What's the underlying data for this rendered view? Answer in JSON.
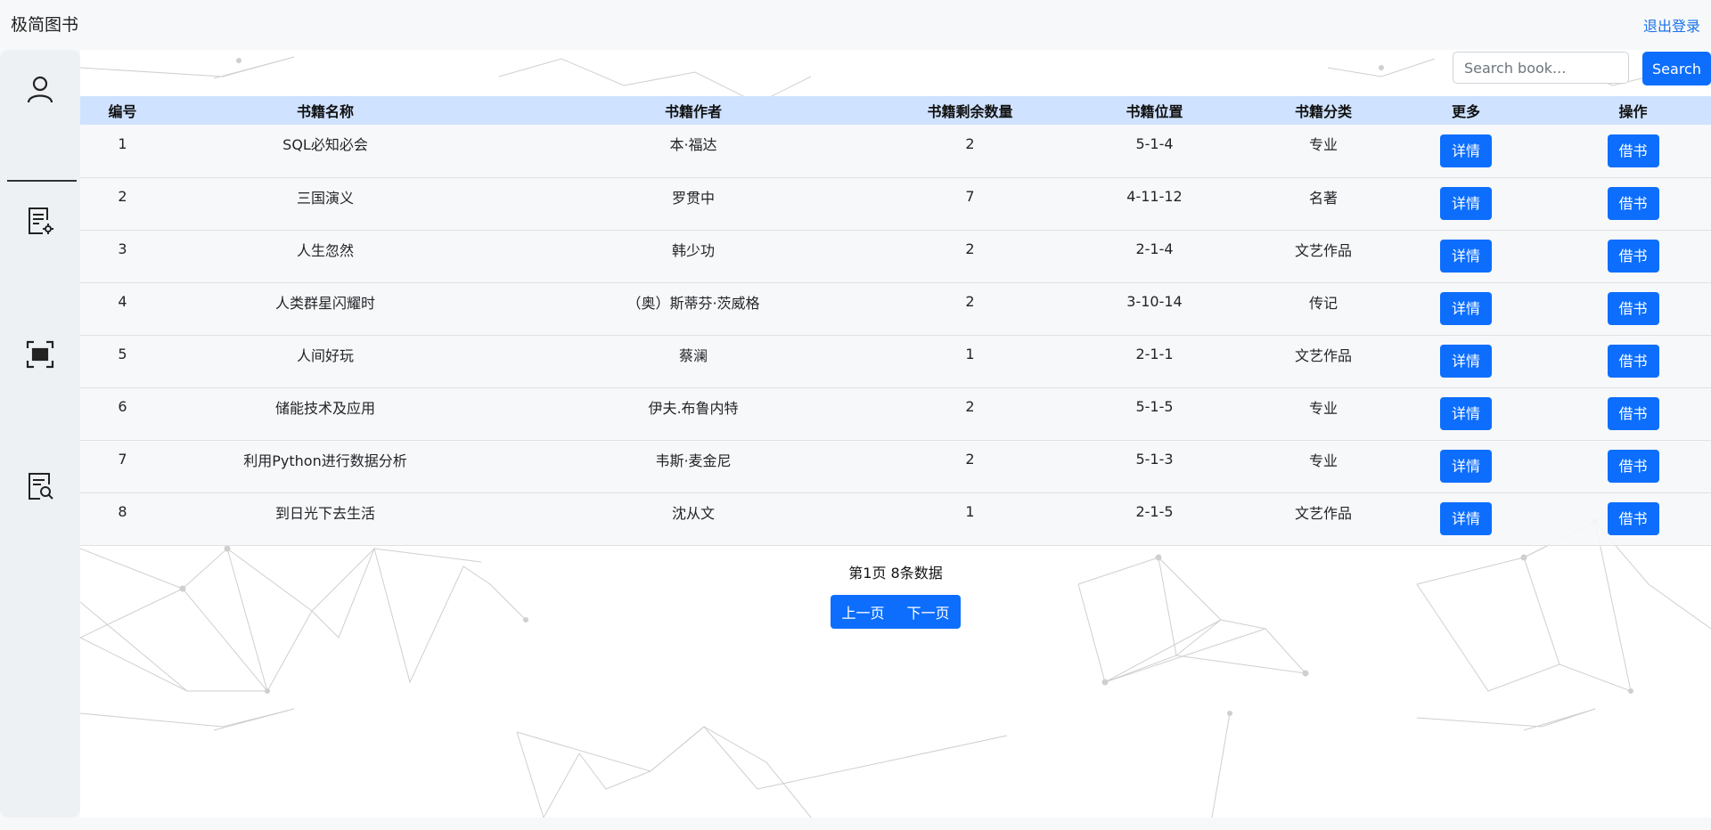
{
  "header": {
    "brand": "极简图书",
    "logout": "退出登录"
  },
  "sidebar": {
    "items": [
      {
        "icon": "user-icon"
      },
      {
        "icon": "book-settings-icon"
      },
      {
        "icon": "scan-icon"
      },
      {
        "icon": "book-search-icon"
      }
    ]
  },
  "search": {
    "placeholder": "Search book...",
    "button": "Search"
  },
  "table": {
    "headers": [
      "编号",
      "书籍名称",
      "书籍作者",
      "书籍剩余数量",
      "书籍位置",
      "书籍分类",
      "更多",
      "操作"
    ],
    "detail_label": "详情",
    "borrow_label": "借书",
    "rows": [
      [
        "1",
        "SQL必知必会",
        "本·福达",
        "2",
        "5-1-4",
        "专业"
      ],
      [
        "2",
        "三国演义",
        "罗贯中",
        "7",
        "4-11-12",
        "名著"
      ],
      [
        "3",
        "人生忽然",
        "韩少功",
        "2",
        "2-1-4",
        "文艺作品"
      ],
      [
        "4",
        "人类群星闪耀时",
        "（奥）斯蒂芬·茨威格",
        "2",
        "3-10-14",
        "传记"
      ],
      [
        "5",
        "人间好玩",
        "蔡澜",
        "1",
        "2-1-1",
        "文艺作品"
      ],
      [
        "6",
        "储能技术及应用",
        "伊夫.布鲁内特",
        "2",
        "5-1-5",
        "专业"
      ],
      [
        "7",
        "利用Python进行数据分析",
        "韦斯·麦金尼",
        "2",
        "5-1-3",
        "专业"
      ],
      [
        "8",
        "到日光下去生活",
        "沈从文",
        "1",
        "2-1-5",
        "文艺作品"
      ]
    ]
  },
  "pagination": {
    "info": "第1页 8条数据",
    "prev": "上一页",
    "next": "下一页"
  },
  "colors": {
    "primary": "#0d6efd",
    "header_bg": "#cfe2ff",
    "link": "#1a73e8"
  }
}
